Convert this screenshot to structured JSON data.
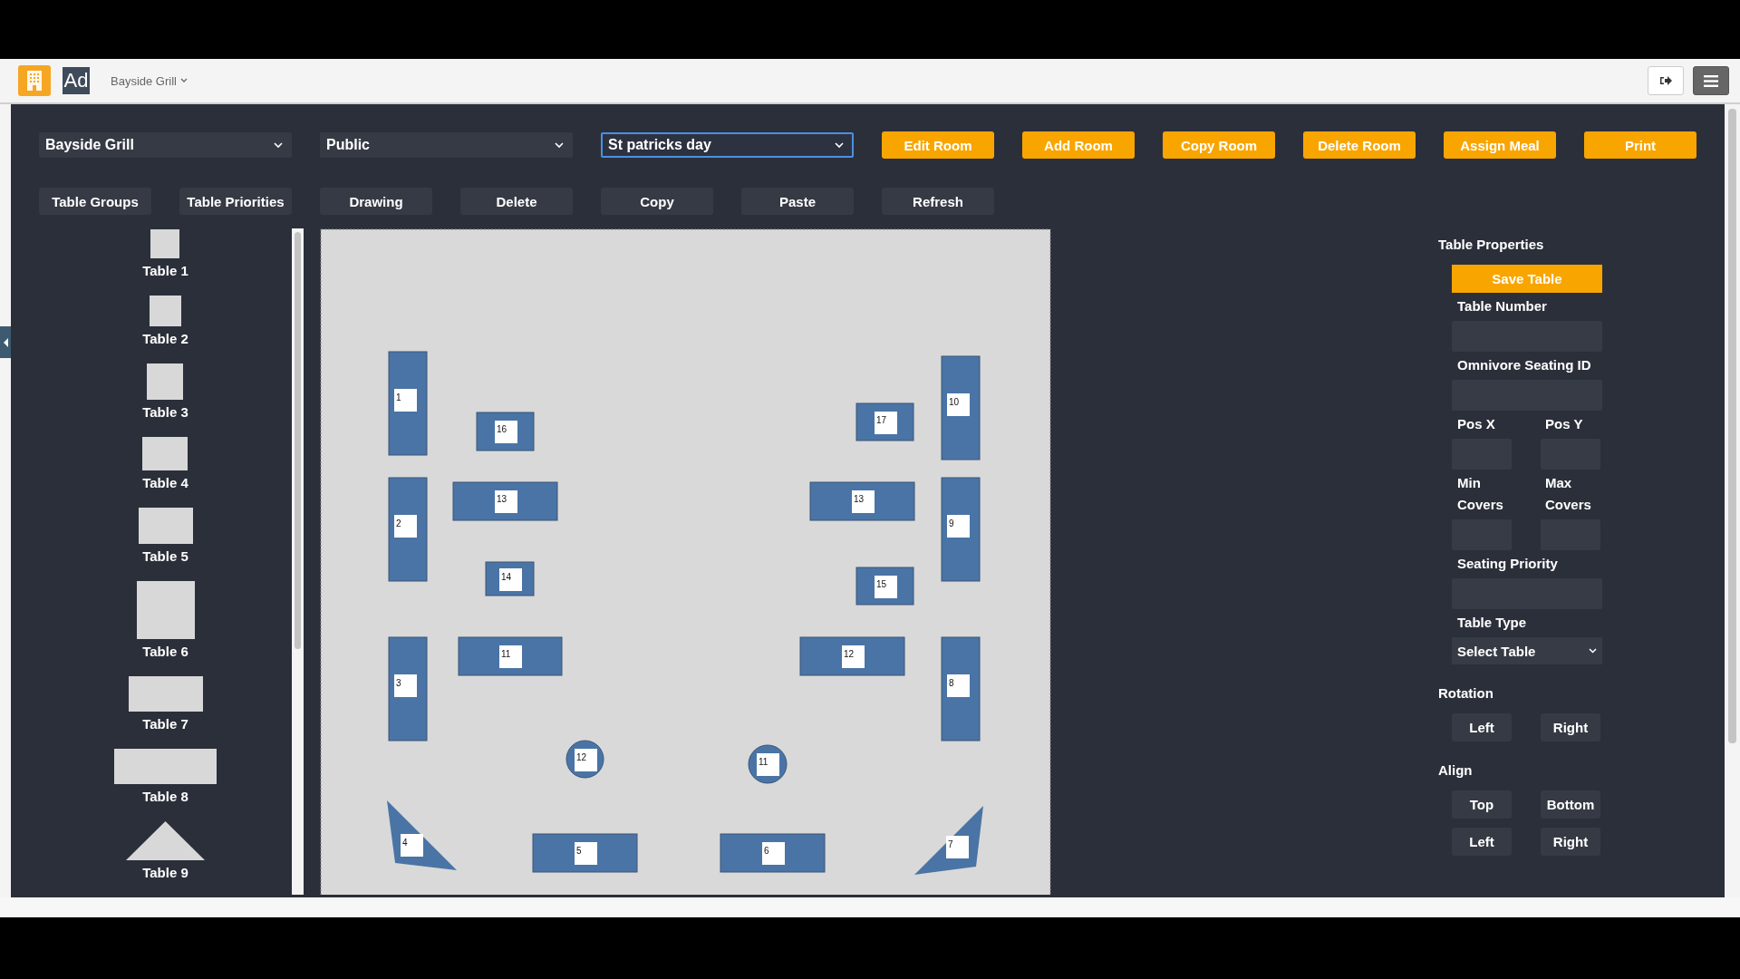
{
  "header": {
    "logo_badge": "Ad",
    "venue": "Bayside Grill"
  },
  "filters": [
    {
      "value": "Bayside Grill",
      "focused": false
    },
    {
      "value": "Public",
      "focused": false
    },
    {
      "value": "St patricks day",
      "focused": true
    }
  ],
  "room_actions": [
    "Edit Room",
    "Add Room",
    "Copy Room",
    "Delete Room",
    "Assign Meal",
    "Print"
  ],
  "tools": [
    "Table Groups",
    "Table Priorities",
    "Drawing",
    "Delete",
    "Copy",
    "Paste",
    "Refresh"
  ],
  "palette": [
    {
      "label": "Table 1",
      "kind": "rect"
    },
    {
      "label": "Table 2",
      "kind": "rect"
    },
    {
      "label": "Table 3",
      "kind": "rect"
    },
    {
      "label": "Table 4",
      "kind": "rect"
    },
    {
      "label": "Table 5",
      "kind": "rect"
    },
    {
      "label": "Table 6",
      "kind": "rect"
    },
    {
      "label": "Table 7",
      "kind": "rect"
    },
    {
      "label": "Table 8",
      "kind": "rect"
    },
    {
      "label": "Table 9",
      "kind": "triangle"
    }
  ],
  "floor_tables": [
    {
      "number": "1",
      "kind": "rect"
    },
    {
      "number": "16",
      "kind": "rect"
    },
    {
      "number": "2",
      "kind": "rect"
    },
    {
      "number": "13",
      "kind": "rect"
    },
    {
      "number": "14",
      "kind": "rect"
    },
    {
      "number": "3",
      "kind": "rect"
    },
    {
      "number": "11",
      "kind": "rect"
    },
    {
      "number": "12",
      "kind": "circle"
    },
    {
      "number": "4",
      "kind": "triangle"
    },
    {
      "number": "5",
      "kind": "rect"
    },
    {
      "number": "6",
      "kind": "rect"
    },
    {
      "number": "11",
      "kind": "circle"
    },
    {
      "number": "7",
      "kind": "triangle"
    },
    {
      "number": "17",
      "kind": "rect"
    },
    {
      "number": "10",
      "kind": "rect"
    },
    {
      "number": "13",
      "kind": "rect"
    },
    {
      "number": "9",
      "kind": "rect"
    },
    {
      "number": "15",
      "kind": "rect"
    },
    {
      "number": "12",
      "kind": "rect"
    },
    {
      "number": "8",
      "kind": "rect"
    }
  ],
  "properties": {
    "title": "Table Properties",
    "save": "Save Table",
    "fields": [
      {
        "kind": "text",
        "label": "Table Number"
      },
      {
        "kind": "pair",
        "items": [
          {
            "label": "Omnivore Seating ID"
          }
        ]
      },
      {
        "kind": "pair",
        "items": [
          {
            "label": "Pos X"
          },
          {
            "label": "Pos Y"
          }
        ]
      },
      {
        "kind": "pair",
        "items": [
          {
            "label": "Min Covers"
          },
          {
            "label": "Max Covers"
          }
        ]
      },
      {
        "kind": "text",
        "label": "Seating Priority"
      },
      {
        "kind": "select",
        "label": "Table Type",
        "value": "Select Table"
      }
    ]
  },
  "rotation": {
    "title": "Rotation",
    "buttons": [
      "Left",
      "Right"
    ]
  },
  "align": {
    "title": "Align",
    "buttons": [
      "Top",
      "Bottom",
      "Left",
      "Right"
    ]
  }
}
